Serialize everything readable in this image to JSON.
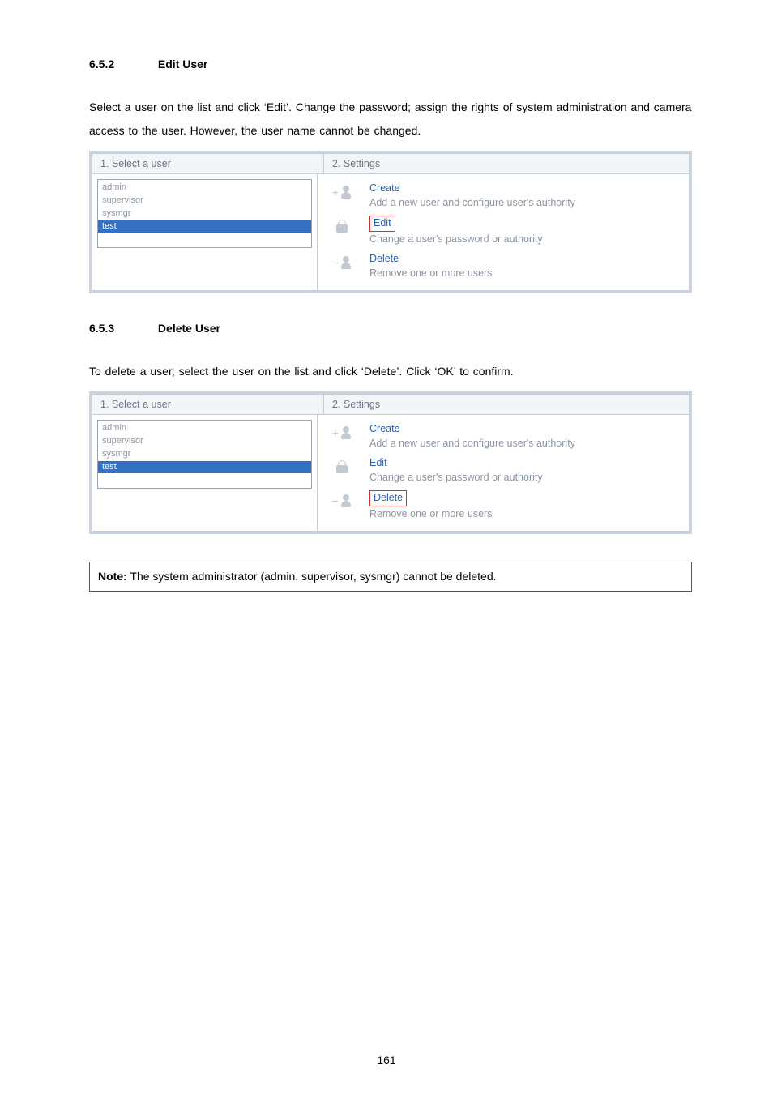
{
  "sections": {
    "edit_user": {
      "num": "6.5.2",
      "title": "Edit User",
      "para": "Select a user on the list and click ‘Edit’.   Change the password; assign the rights of system administration and camera access to the user.   However, the user name cannot be changed."
    },
    "delete_user": {
      "num": "6.5.3",
      "title": "Delete User",
      "para": "To delete a user, select the user on the list and click ‘Delete’.   Click ‘OK’ to confirm."
    }
  },
  "panel": {
    "col1": "1. Select a user",
    "col2": "2. Settings",
    "users": [
      "admin",
      "supervisor",
      "sysmgr",
      "test"
    ],
    "selected": "test",
    "actions": {
      "create": {
        "label": "Create",
        "desc": "Add a new user and configure user's authority"
      },
      "edit": {
        "label": "Edit",
        "desc": "Change a user's password or authority"
      },
      "delete": {
        "label": "Delete",
        "desc": "Remove one or more users"
      }
    }
  },
  "note": {
    "bold": "Note:",
    "text": " The system administrator (admin, supervisor, sysmgr) cannot be deleted."
  },
  "page_number": "161"
}
